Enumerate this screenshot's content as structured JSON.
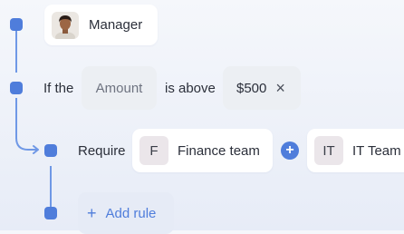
{
  "approver": {
    "label": "Manager"
  },
  "condition": {
    "prefix": "If the",
    "field": "Amount",
    "operator": "is above",
    "value": "$500",
    "remove_symbol": "×"
  },
  "requirement": {
    "label": "Require",
    "teams": [
      {
        "initial": "F",
        "name": "Finance team"
      },
      {
        "initial": "IT",
        "name": "IT Team"
      }
    ],
    "add_symbol": "+"
  },
  "add_rule": {
    "symbol": "+",
    "label": "Add rule"
  },
  "colors": {
    "accent": "#4f7ddb",
    "connector": "#6f98e6"
  }
}
